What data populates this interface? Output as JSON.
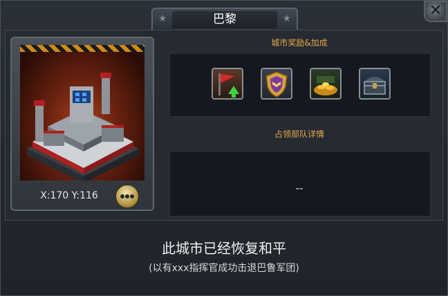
{
  "window": {
    "title": "巴黎"
  },
  "city": {
    "coords": "X:170 Y:116"
  },
  "rewards": {
    "label": "城市奖励&加成",
    "icons": [
      "flag-upgrade-icon",
      "purple-shield-medal-icon",
      "gold-treasure-pile-icon",
      "treasure-chest-icon"
    ]
  },
  "troops": {
    "label": "占领部队详情",
    "value": "--"
  },
  "status": {
    "main": "此城市已经恢复和平",
    "sub": "(以有xxx指挥官成功击退巴鲁军团)"
  },
  "colors": {
    "accent": "#e6a94a",
    "background": "#23272e"
  }
}
